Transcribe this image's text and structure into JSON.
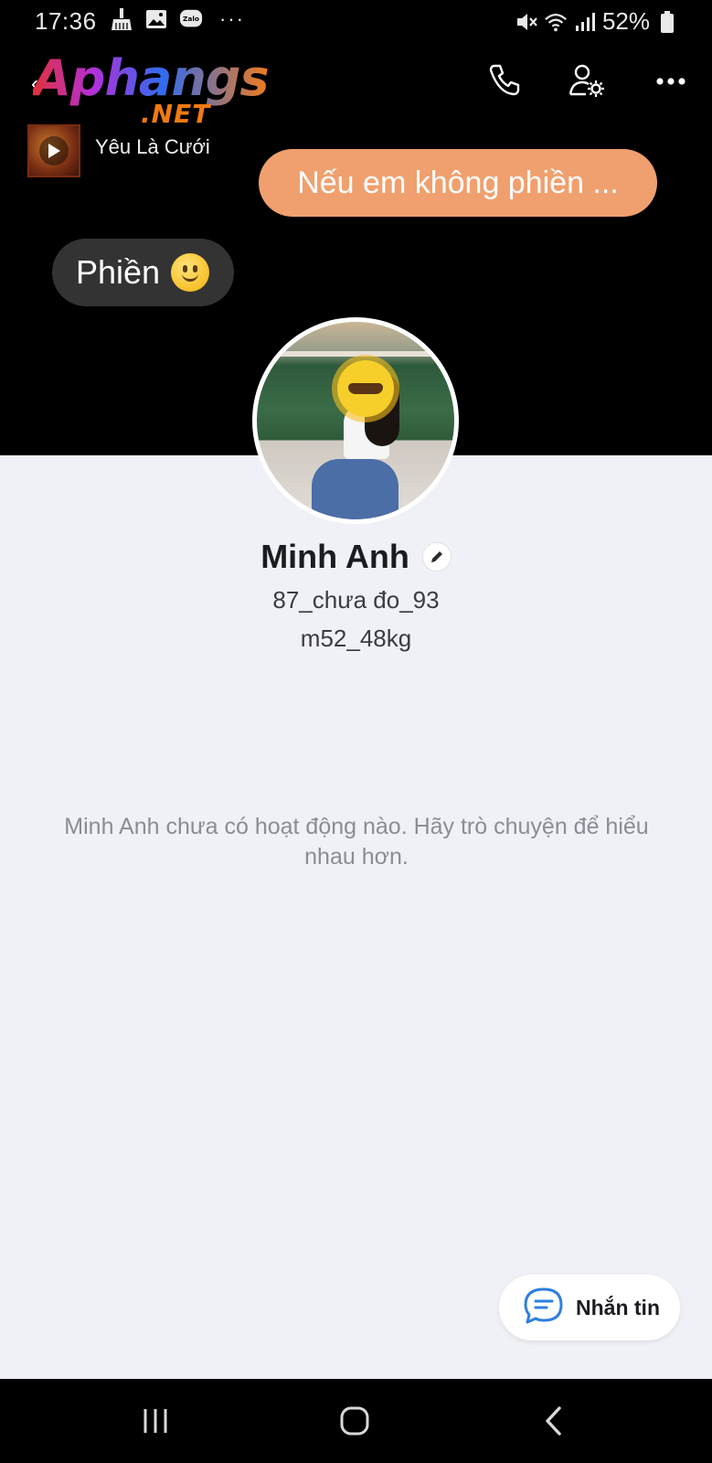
{
  "status_bar": {
    "time": "17:36",
    "left_icons": [
      "broom-icon",
      "image-icon",
      "zalo-icon"
    ],
    "more": "···",
    "battery_percent": "52%"
  },
  "header": {
    "logo_main": "Aphangs",
    "logo_sub": ".NET",
    "actions": [
      "phone-icon",
      "user-settings-icon",
      "more-icon"
    ]
  },
  "music": {
    "title": "Yêu Là Cưới"
  },
  "bubbles": {
    "right_text": "Nếu em không phiền ...",
    "left_text": "Phiền"
  },
  "profile": {
    "name": "Minh Anh",
    "bio_line1": "87_chưa đo_93",
    "bio_line2": "m52_48kg"
  },
  "empty_state": {
    "message": "Minh Anh chưa có hoạt động nào. Hãy trò chuyện để hiểu nhau hơn."
  },
  "message_button": {
    "label": "Nhắn tin"
  },
  "colors": {
    "accent_bubble": "#f0a06e",
    "dark_bubble": "#333333",
    "message_icon": "#2f7fe0",
    "logo_orange": "#f07a12"
  }
}
